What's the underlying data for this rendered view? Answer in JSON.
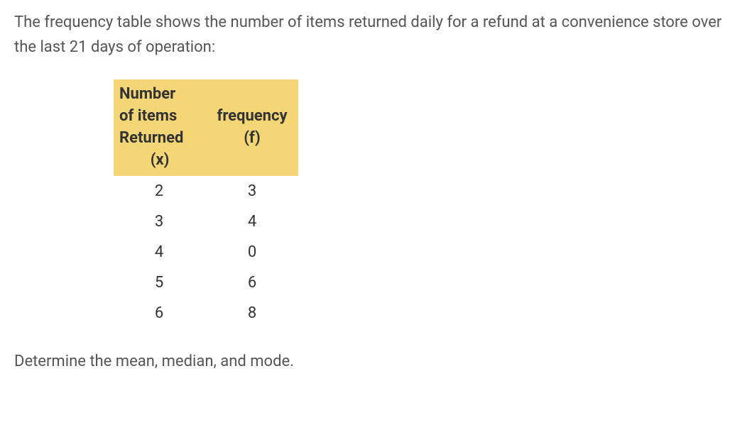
{
  "intro": "The frequency table shows the number of items returned daily for a refund at a convenience store over the last 21 days of operation:",
  "table": {
    "header1_line1": "Number",
    "header1_line2": "of items",
    "header1_line3": "Returned",
    "header1_line4": "(x)",
    "header2_line1": "frequency",
    "header2_line2": "(f)",
    "rows": [
      {
        "x": "2",
        "f": "3"
      },
      {
        "x": "3",
        "f": "4"
      },
      {
        "x": "4",
        "f": "0"
      },
      {
        "x": "5",
        "f": "6"
      },
      {
        "x": "6",
        "f": "8"
      }
    ]
  },
  "question": "Determine the mean, median, and mode.",
  "chart_data": {
    "type": "table",
    "title": "Frequency table of items returned daily for refund over 21 days",
    "columns": [
      "Number of items Returned (x)",
      "frequency (f)"
    ],
    "data": [
      {
        "x": 2,
        "f": 3
      },
      {
        "x": 3,
        "f": 4
      },
      {
        "x": 4,
        "f": 0
      },
      {
        "x": 5,
        "f": 6
      },
      {
        "x": 6,
        "f": 8
      }
    ]
  }
}
